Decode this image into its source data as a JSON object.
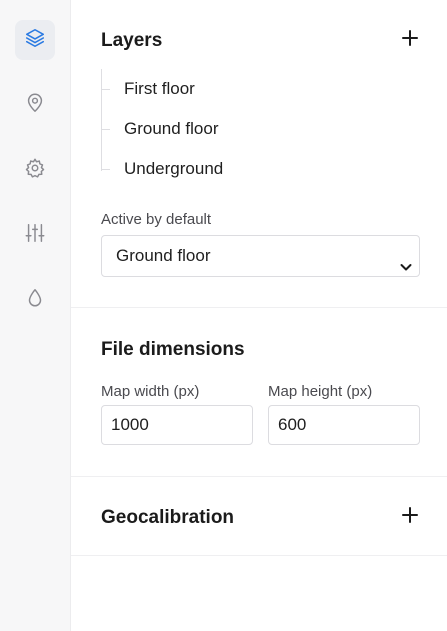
{
  "rail": {
    "items": [
      {
        "icon": "layers-icon",
        "active": true
      },
      {
        "icon": "map-pin-icon",
        "active": false
      },
      {
        "icon": "gear-icon",
        "active": false
      },
      {
        "icon": "sliders-icon",
        "active": false
      },
      {
        "icon": "droplet-icon",
        "active": false
      }
    ],
    "active_color": "#2a7ae2",
    "icon_color": "#8a8a90"
  },
  "layers": {
    "title": "Layers",
    "items": [
      "First floor",
      "Ground floor",
      "Underground"
    ],
    "active_label": "Active by default",
    "active_value": "Ground floor"
  },
  "dimensions": {
    "title": "File dimensions",
    "width_label": "Map width (px)",
    "width_value": "1000",
    "height_label": "Map height (px)",
    "height_value": "600"
  },
  "geocalibration": {
    "title": "Geocalibration"
  }
}
